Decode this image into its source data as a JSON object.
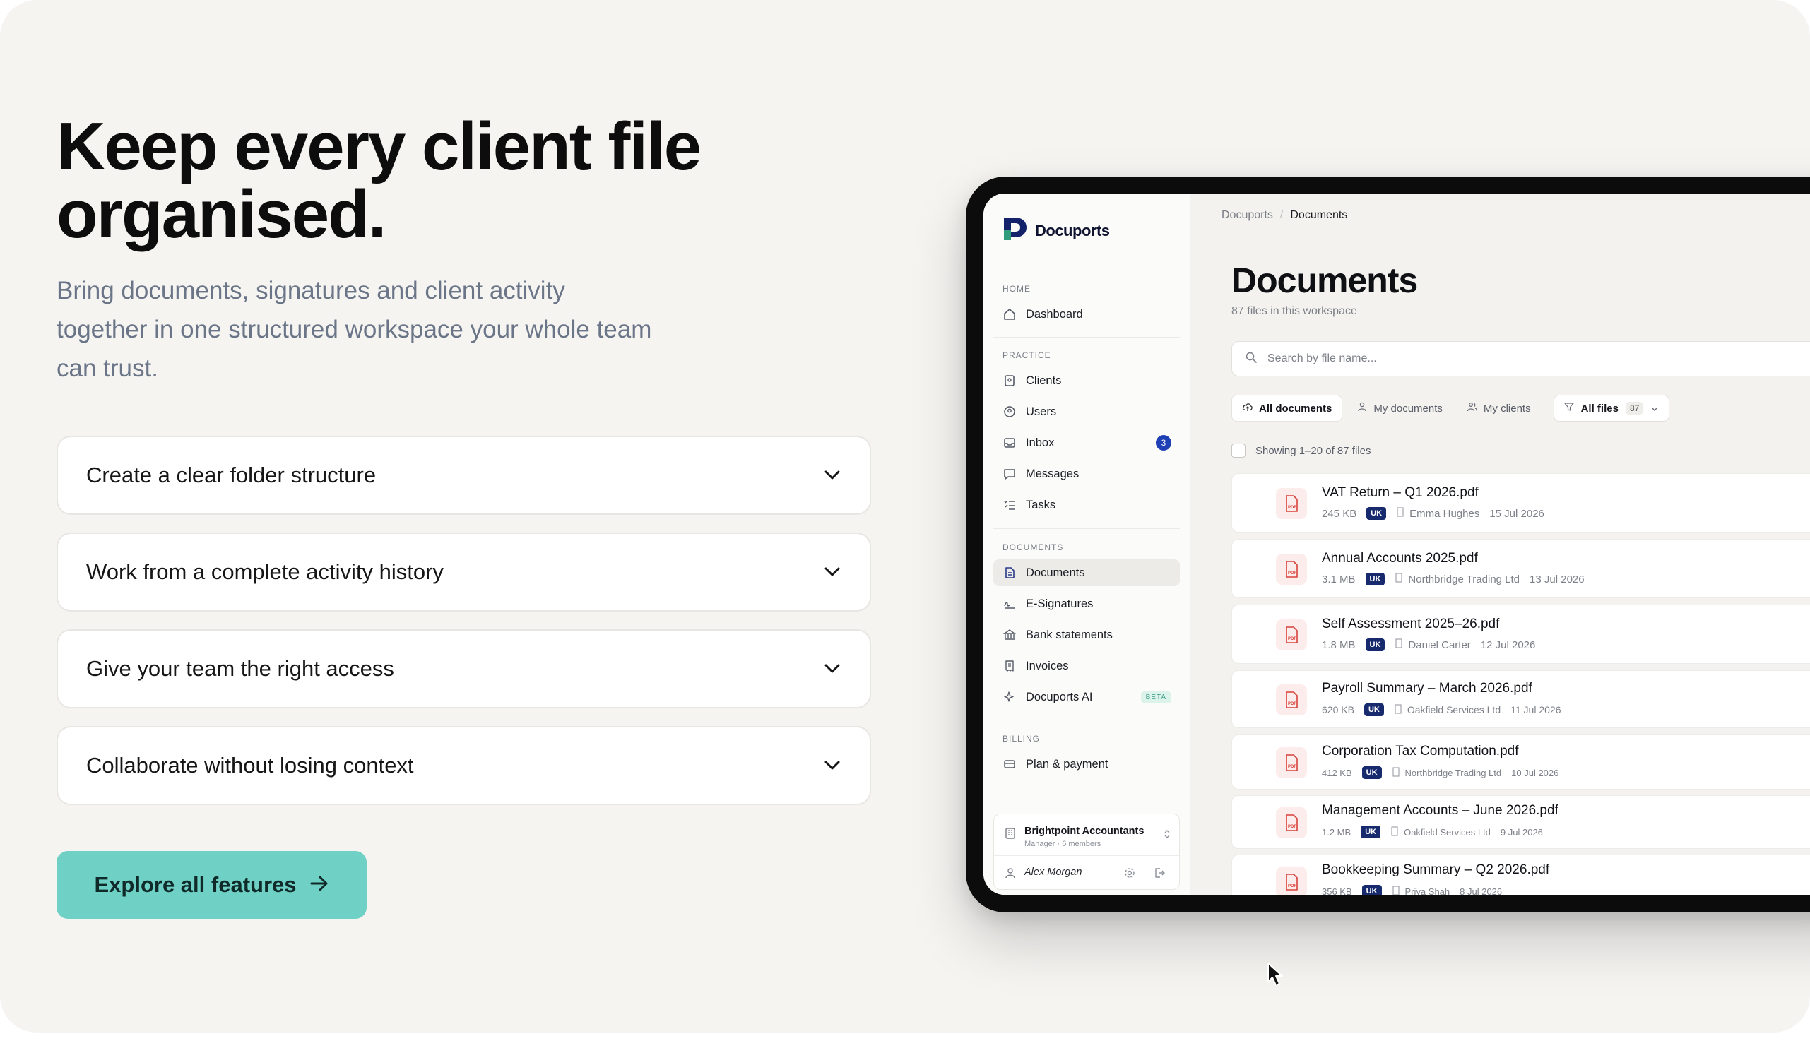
{
  "hero": {
    "title_line1": "Keep every client file",
    "title_line2": "organised.",
    "subtitle_line1": "Bring documents, signatures and client activity",
    "subtitle_line2": "together in one structured workspace your whole team",
    "subtitle_line3": "can trust."
  },
  "accordion": [
    {
      "label": "Create a clear folder structure"
    },
    {
      "label": "Work from a complete activity history"
    },
    {
      "label": "Give your team the right access"
    },
    {
      "label": "Collaborate without losing context"
    }
  ],
  "cta": {
    "label": "Explore all features"
  },
  "app": {
    "brand": "Docuports",
    "sections": {
      "home": "HOME",
      "practice": "PRACTICE",
      "documents": "DOCUMENTS",
      "billing": "BILLING"
    },
    "nav": {
      "dashboard": "Dashboard",
      "clients": "Clients",
      "users": "Users",
      "inbox": "Inbox",
      "inbox_count": "3",
      "messages": "Messages",
      "tasks": "Tasks",
      "documents": "Documents",
      "esignatures": "E-Signatures",
      "bank": "Bank statements",
      "invoices": "Invoices",
      "ai": "Docuports AI",
      "ai_badge": "BETA",
      "plan": "Plan & payment"
    },
    "workspace": {
      "name": "Brightpoint Accountants",
      "role": "Manager · 6 members",
      "user": "Alex Morgan"
    },
    "breadcrumb": {
      "root": "Docuports",
      "separator": "/",
      "current": "Documents"
    },
    "page_title": "Documents",
    "file_count": "87 files in this workspace",
    "search_placeholder": "Search by file name...",
    "filters": {
      "all": "All documents",
      "mine": "My documents",
      "clients": "My clients",
      "select": "All files",
      "select_count": "87"
    },
    "showing": "Showing 1–20 of 87 files",
    "files": [
      {
        "name": "VAT Return – Q1 2026.pdf",
        "size": "245 KB",
        "tag": "UK",
        "client": "Emma Hughes",
        "date": "15 Jul 2026"
      },
      {
        "name": "Annual Accounts 2025.pdf",
        "size": "3.1 MB",
        "tag": "UK",
        "client": "Northbridge Trading Ltd",
        "date": "13 Jul 2026"
      },
      {
        "name": "Self Assessment 2025–26.pdf",
        "size": "1.8 MB",
        "tag": "UK",
        "client": "Daniel Carter",
        "date": "12 Jul 2026"
      },
      {
        "name": "Payroll Summary – March 2026.pdf",
        "size": "620 KB",
        "tag": "UK",
        "client": "Oakfield Services Ltd",
        "date": "11 Jul 2026"
      },
      {
        "name": "Corporation Tax Computation.pdf",
        "size": "412 KB",
        "tag": "UK",
        "client": "Northbridge Trading Ltd",
        "date": "10 Jul 2026"
      },
      {
        "name": "Management Accounts – June 2026.pdf",
        "size": "1.2 MB",
        "tag": "UK",
        "client": "Oakfield Services Ltd",
        "date": "9 Jul 2026"
      },
      {
        "name": "Bookkeeping Summary – Q2 2026.pdf",
        "size": "356 KB",
        "tag": "UK",
        "client": "Priya Shah",
        "date": "8 Jul 2026"
      }
    ]
  },
  "colors": {
    "accent_teal": "#6fd0c6",
    "brand_navy": "#172a6e",
    "inbox_badge": "#1f3fb4",
    "pdf_red": "#d9423a"
  }
}
